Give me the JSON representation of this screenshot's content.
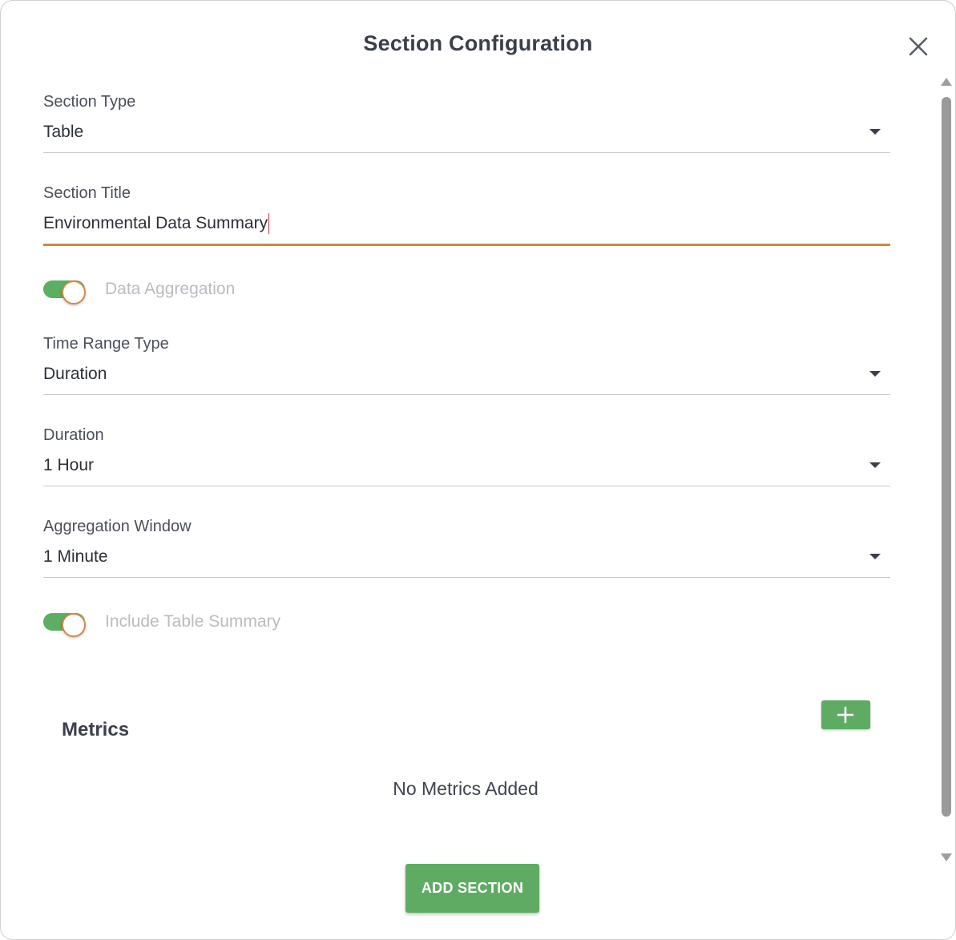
{
  "dialog": {
    "title": "Section Configuration"
  },
  "form": {
    "section_type": {
      "label": "Section Type",
      "value": "Table"
    },
    "section_title": {
      "label": "Section Title",
      "value": "Environmental Data Summary"
    },
    "data_aggregation": {
      "label": "Data Aggregation",
      "enabled": true
    },
    "time_range_type": {
      "label": "Time Range Type",
      "value": "Duration"
    },
    "duration": {
      "label": "Duration",
      "value": "1 Hour"
    },
    "aggregation_window": {
      "label": "Aggregation Window",
      "value": "1 Minute"
    },
    "include_table_summary": {
      "label": "Include Table Summary",
      "enabled": true
    }
  },
  "metrics": {
    "title": "Metrics",
    "empty_text": "No Metrics Added"
  },
  "actions": {
    "add_section_label": "ADD SECTION"
  },
  "icons": {
    "close": "close-icon",
    "add": "plus-icon",
    "dropdown": "caret-down-icon"
  },
  "colors": {
    "accent_green": "#5fab64",
    "focus_underline": "#c98a4a",
    "title_text": "#3a3f4b"
  }
}
